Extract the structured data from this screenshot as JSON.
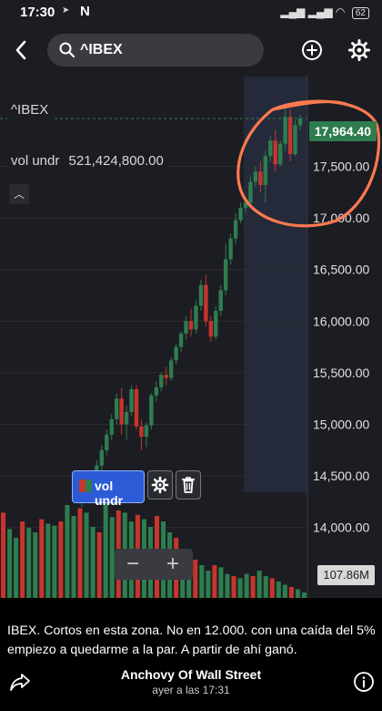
{
  "status_bar": {
    "time": "17:30",
    "app_letter": "N",
    "battery": "62"
  },
  "header": {
    "search_query": "^IBEX"
  },
  "chart": {
    "symbol": "^IBEX",
    "volume_label": "vol undr",
    "volume_value": "521,424,800.00",
    "last_price_tag": "17,964.40",
    "volume_tag": "107.86M",
    "indicator_chip_label": "vol undr",
    "zoom_out_label": "−",
    "zoom_in_label": "+",
    "colors": {
      "up": "#2e7d4f",
      "down": "#c6352e",
      "background": "#1c1d22",
      "highlight_ring": "#ff7a4f",
      "indicator_chip": "#2b5bd7"
    }
  },
  "chart_data": {
    "type": "candlestick",
    "title": "^IBEX",
    "y_ticks": [
      17500,
      17000,
      16500,
      16000,
      15500,
      15000,
      14500,
      14000
    ],
    "y_tick_labels": [
      "17,500.00",
      "17,000.00",
      "16,500.00",
      "16,000.00",
      "15,500.00",
      "15,000.00",
      "14,500.00",
      "14,000.00"
    ],
    "ylim": [
      13600,
      18300
    ],
    "last_price": 17964.4,
    "last_volume_label": "107.86M",
    "candles": [
      [
        14300,
        14450,
        14200,
        14380
      ],
      [
        14380,
        14500,
        14300,
        14420
      ],
      [
        14420,
        14550,
        14350,
        14470
      ],
      [
        14470,
        14650,
        14420,
        14600
      ],
      [
        14600,
        14800,
        14550,
        14750
      ],
      [
        14750,
        14950,
        14700,
        14900
      ],
      [
        14900,
        15100,
        14850,
        15050
      ],
      [
        15050,
        15300,
        15000,
        15250
      ],
      [
        15250,
        15350,
        14900,
        15000
      ],
      [
        15000,
        15180,
        14850,
        15120
      ],
      [
        15120,
        15380,
        15080,
        15340
      ],
      [
        15340,
        15380,
        14950,
        14980
      ],
      [
        14980,
        15050,
        14750,
        14880
      ],
      [
        14880,
        15020,
        14780,
        14990
      ],
      [
        14990,
        15300,
        14950,
        15280
      ],
      [
        15280,
        15420,
        15220,
        15360
      ],
      [
        15360,
        15500,
        15320,
        15480
      ],
      [
        15480,
        15560,
        15380,
        15450
      ],
      [
        15450,
        15650,
        15420,
        15620
      ],
      [
        15620,
        15780,
        15580,
        15750
      ],
      [
        15750,
        15900,
        15700,
        15880
      ],
      [
        15880,
        16050,
        15820,
        16000
      ],
      [
        16000,
        16120,
        15850,
        15920
      ],
      [
        15920,
        16200,
        15880,
        16150
      ],
      [
        16150,
        16400,
        16100,
        16350
      ],
      [
        16350,
        16450,
        15950,
        16000
      ],
      [
        16000,
        16050,
        15800,
        15850
      ],
      [
        15850,
        16150,
        15820,
        16100
      ],
      [
        16100,
        16350,
        16050,
        16300
      ],
      [
        16300,
        16750,
        16250,
        16600
      ],
      [
        16600,
        16850,
        16550,
        16800
      ],
      [
        16800,
        17050,
        16750,
        16980
      ],
      [
        16980,
        17150,
        16950,
        17100
      ],
      [
        17100,
        17200,
        17050,
        17150
      ],
      [
        17150,
        17400,
        17100,
        17350
      ],
      [
        17350,
        17500,
        17300,
        17450
      ],
      [
        17450,
        17550,
        17250,
        17320
      ],
      [
        17320,
        17650,
        17150,
        17600
      ],
      [
        17600,
        17800,
        17550,
        17750
      ],
      [
        17750,
        17850,
        17450,
        17520
      ],
      [
        17520,
        17750,
        17500,
        17720
      ],
      [
        17720,
        18100,
        17650,
        17980
      ],
      [
        17980,
        18050,
        17550,
        17620
      ],
      [
        17620,
        17950,
        17600,
        17900
      ],
      [
        17900,
        18000,
        17850,
        17964.4
      ]
    ],
    "volumes": [
      0.78,
      0.63,
      0.55,
      0.7,
      0.64,
      0.6,
      0.72,
      0.68,
      0.66,
      0.7,
      0.85,
      0.75,
      0.82,
      0.78,
      0.65,
      0.6,
      0.88,
      0.74,
      0.8,
      0.78,
      0.7,
      0.76,
      0.72,
      0.65,
      0.75,
      0.7,
      0.6,
      0.55,
      0.45,
      0.4,
      0.35,
      0.3,
      0.25,
      0.3,
      0.28,
      0.22,
      0.2,
      0.18,
      0.22,
      0.2,
      0.25,
      0.2,
      0.18,
      0.15,
      0.12,
      0.1,
      0.08,
      0.05
    ]
  },
  "caption": {
    "text": "IBEX. Cortos en esta zona. No en 12.000. con una caída del 5% empiezo a quedarme a la par. A partir de ahí ganó.",
    "author": "Anchovy Of Wall Street",
    "timestamp": "ayer a las 17:31"
  }
}
